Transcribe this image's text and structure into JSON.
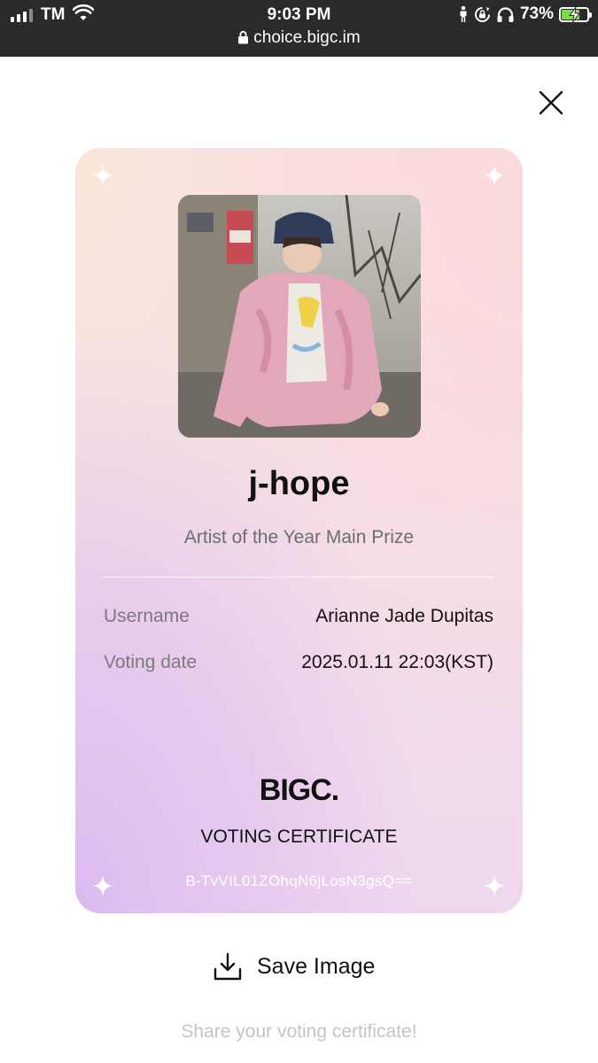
{
  "status_bar": {
    "carrier": "TM",
    "time": "9:03 PM",
    "url": "choice.bigc.im",
    "battery_percent": "73%",
    "battery_level": 0.73
  },
  "icons": [
    "signal-icon",
    "wifi-icon",
    "lock-icon",
    "person-icon",
    "rotation-lock-icon",
    "headphones-icon",
    "battery-icon",
    "close-icon",
    "sparkle-icon",
    "download-icon"
  ],
  "card": {
    "artist_name": "j-hope",
    "award": "Artist of the Year Main Prize",
    "username_label": "Username",
    "username_value": "Arianne Jade Dupitas",
    "voting_date_label": "Voting date",
    "voting_date_value": "2025.01.11 22:03(KST)",
    "brand": "BIGC.",
    "certificate_title": "VOTING CERTIFICATE",
    "certificate_code": "B-TvVIL01ZOhqN6jLosN3gsQ=="
  },
  "actions": {
    "save_label": "Save Image",
    "share_text": "Share your voting certificate!"
  },
  "colors": {
    "status_bar_bg": "#2a2a2a",
    "battery_fill": "#7ddc4a",
    "card_pink": "#f8e0e0",
    "card_lavender": "#dcbaf0"
  }
}
